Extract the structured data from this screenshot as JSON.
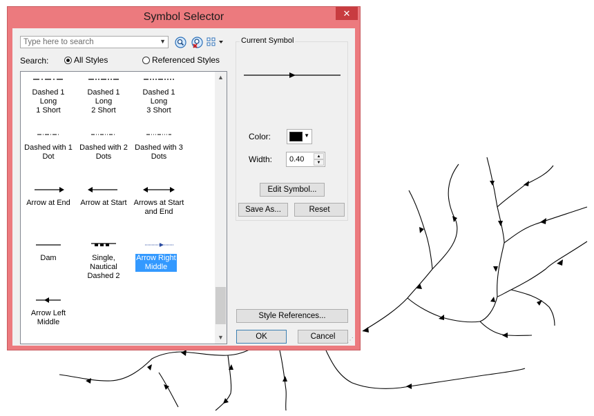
{
  "dialog": {
    "title": "Symbol Selector",
    "close_label": "✕",
    "search": {
      "placeholder": "Type here to search",
      "value": "",
      "label": "Search:",
      "options": [
        "All Styles",
        "Referenced Styles"
      ],
      "selected": "All Styles"
    },
    "toolbar_icons": [
      "search-icon",
      "clear-search-icon",
      "view-options-icon"
    ],
    "symbols": [
      {
        "label_lines": [
          "Dashed 1 Long",
          "1 Short"
        ]
      },
      {
        "label_lines": [
          "Dashed 1 Long",
          "2 Short"
        ]
      },
      {
        "label_lines": [
          "Dashed 1 Long",
          "3 Short"
        ]
      },
      {
        "label_lines": [
          "Dashed with 1",
          "Dot"
        ]
      },
      {
        "label_lines": [
          "Dashed with 2",
          "Dots"
        ]
      },
      {
        "label_lines": [
          "Dashed with 3",
          "Dots"
        ]
      },
      {
        "label_lines": [
          "Arrow at End"
        ]
      },
      {
        "label_lines": [
          "Arrow at Start"
        ]
      },
      {
        "label_lines": [
          "Arrows at Start",
          "and End"
        ]
      },
      {
        "label_lines": [
          "Dam"
        ]
      },
      {
        "label_lines": [
          "Single, Nautical",
          "Dashed 2"
        ]
      },
      {
        "label_lines": [
          "Arrow Right",
          "Middle"
        ],
        "selected": true
      },
      {
        "label_lines": [
          "Arrow Left",
          "Middle"
        ]
      }
    ],
    "current_symbol": {
      "group_title": "Current Symbol",
      "color_label": "Color:",
      "color": "#000000",
      "width_label": "Width:",
      "width_value": "0.40",
      "edit_button": "Edit Symbol...",
      "save_as_button": "Save As...",
      "reset_button": "Reset"
    },
    "style_references_button": "Style References...",
    "ok_button": "OK",
    "cancel_button": "Cancel"
  },
  "colors": {
    "title_bar": "#ec7a7e",
    "close_button": "#c83c40",
    "selection": "#3399ff",
    "client": "#f0f0f0"
  }
}
